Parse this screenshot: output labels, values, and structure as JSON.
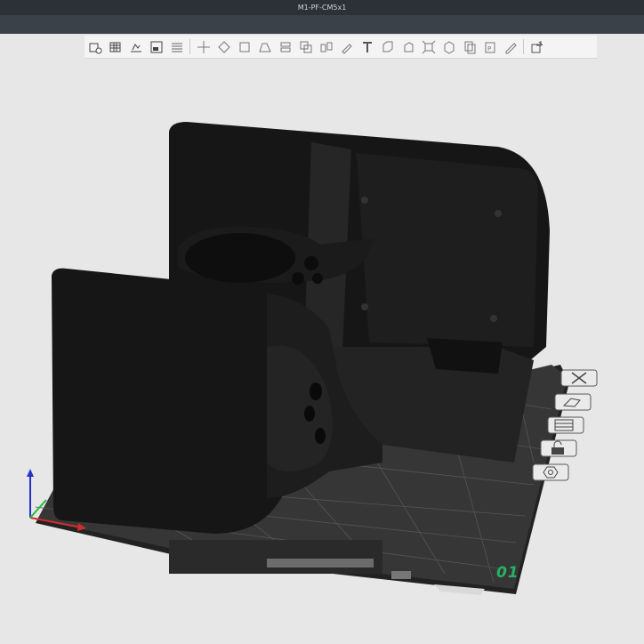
{
  "window": {
    "title": "M1-PF-CM5x1"
  },
  "toolbar": {
    "groups": [
      [
        "add-part-icon",
        "grid-icon",
        "arrange-icon",
        "plate-icon",
        "layers-icon"
      ],
      [
        "move-icon",
        "rotate-icon",
        "scale-icon",
        "place-face-icon",
        "cut-icon",
        "mesh-boolean-icon",
        "split-objects-icon",
        "support-paint-icon",
        "text-emboss-icon",
        "measure-icon",
        "assembly-icon",
        "fit-icon",
        "cube-view-icon",
        "copy-icon",
        "paste-icon",
        "edit-icon"
      ],
      [
        "variable-layer-icon"
      ]
    ]
  },
  "side_tools": [
    "close-icon",
    "orient-icon",
    "plate-settings-icon",
    "lock-icon",
    "settings-icon"
  ],
  "plate": {
    "number": "01"
  },
  "colors": {
    "axis_x": "#d12c2c",
    "axis_y": "#1fbd3a",
    "axis_z": "#2433c9",
    "model": "#1b1b1b",
    "bed_grid": "#2f2f2f",
    "plate_number": "#27b063"
  }
}
